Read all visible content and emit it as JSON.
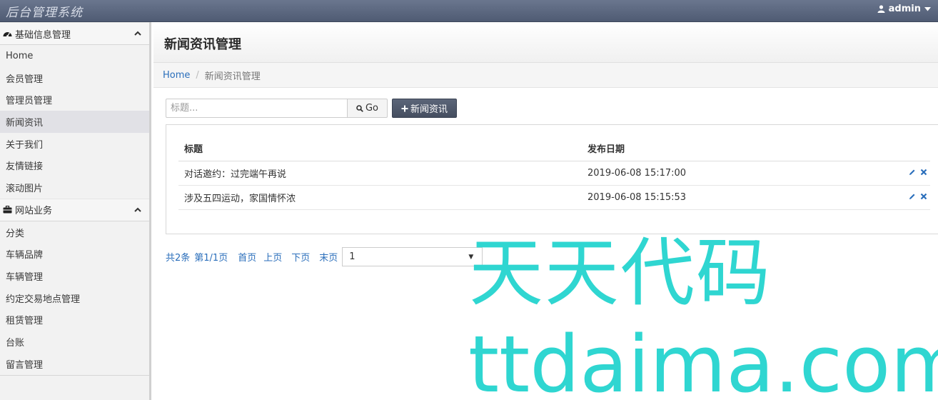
{
  "app": {
    "title": "后台管理系统",
    "user": "admin"
  },
  "sidebar": {
    "sections": [
      {
        "label": "基础信息管理",
        "icon": "dashboard-icon",
        "expanded": true,
        "items": [
          "Home",
          "会员管理",
          "管理员管理",
          "新闻资讯",
          "关于我们",
          "友情链接",
          "滚动图片"
        ]
      },
      {
        "label": "网站业务",
        "icon": "briefcase-icon",
        "expanded": true,
        "items": [
          "分类",
          "车辆品牌",
          "车辆管理",
          "约定交易地点管理",
          "租赁管理",
          "台账",
          "留言管理"
        ]
      }
    ],
    "active_item": "新闻资讯"
  },
  "page": {
    "title": "新闻资讯管理",
    "breadcrumb": {
      "home": "Home",
      "current": "新闻资讯管理"
    }
  },
  "toolbar": {
    "search_placeholder": "标题...",
    "go_label": "Go",
    "add_label": "新闻资讯"
  },
  "table": {
    "headers": {
      "title": "标题",
      "date": "发布日期"
    },
    "rows": [
      {
        "title": "对话邀约：过完端午再说",
        "date": "2019-06-08 15:17:00"
      },
      {
        "title": "涉及五四运动，家国情怀浓",
        "date": "2019-06-08 15:15:53"
      }
    ]
  },
  "pager": {
    "total": "共2条",
    "page_info": "第1/1页",
    "first": "首页",
    "prev": "上页",
    "next": "下页",
    "last": "末页",
    "selected": "1"
  },
  "watermark": {
    "cn": "天天代码",
    "en": "ttdaima.com"
  },
  "colors": {
    "topbar": "#5e6a82",
    "link": "#2a6ebb",
    "button_dark": "#4f586b",
    "watermark": "#2fd6d1",
    "active_item_bg": "#e1e1e6"
  }
}
